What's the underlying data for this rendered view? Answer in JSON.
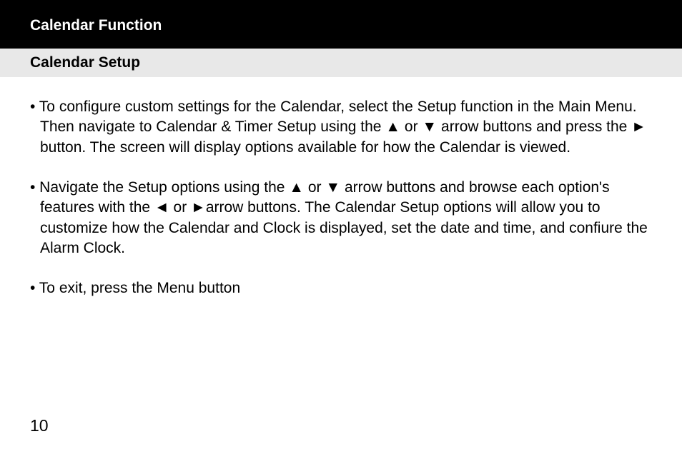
{
  "header": {
    "title": "Calendar Function"
  },
  "subheader": {
    "title": "Calendar Setup"
  },
  "content": {
    "bullets": [
      "• To configure custom settings for the Calendar, select the Setup function in the Main Menu.  Then navigate to Calendar & Timer Setup using the ▲ or ▼ arrow buttons and press the ► button.  The screen will display options available for how the Calendar is viewed.",
      "• Navigate the Setup options using the ▲ or ▼ arrow buttons and browse each option's features with the ◄ or ►arrow buttons.  The Calendar Setup options will allow you to customize how the Calendar and Clock is displayed, set the date and time, and confiure the Alarm Clock.",
      "• To exit, press the Menu button"
    ]
  },
  "page_number": "10"
}
